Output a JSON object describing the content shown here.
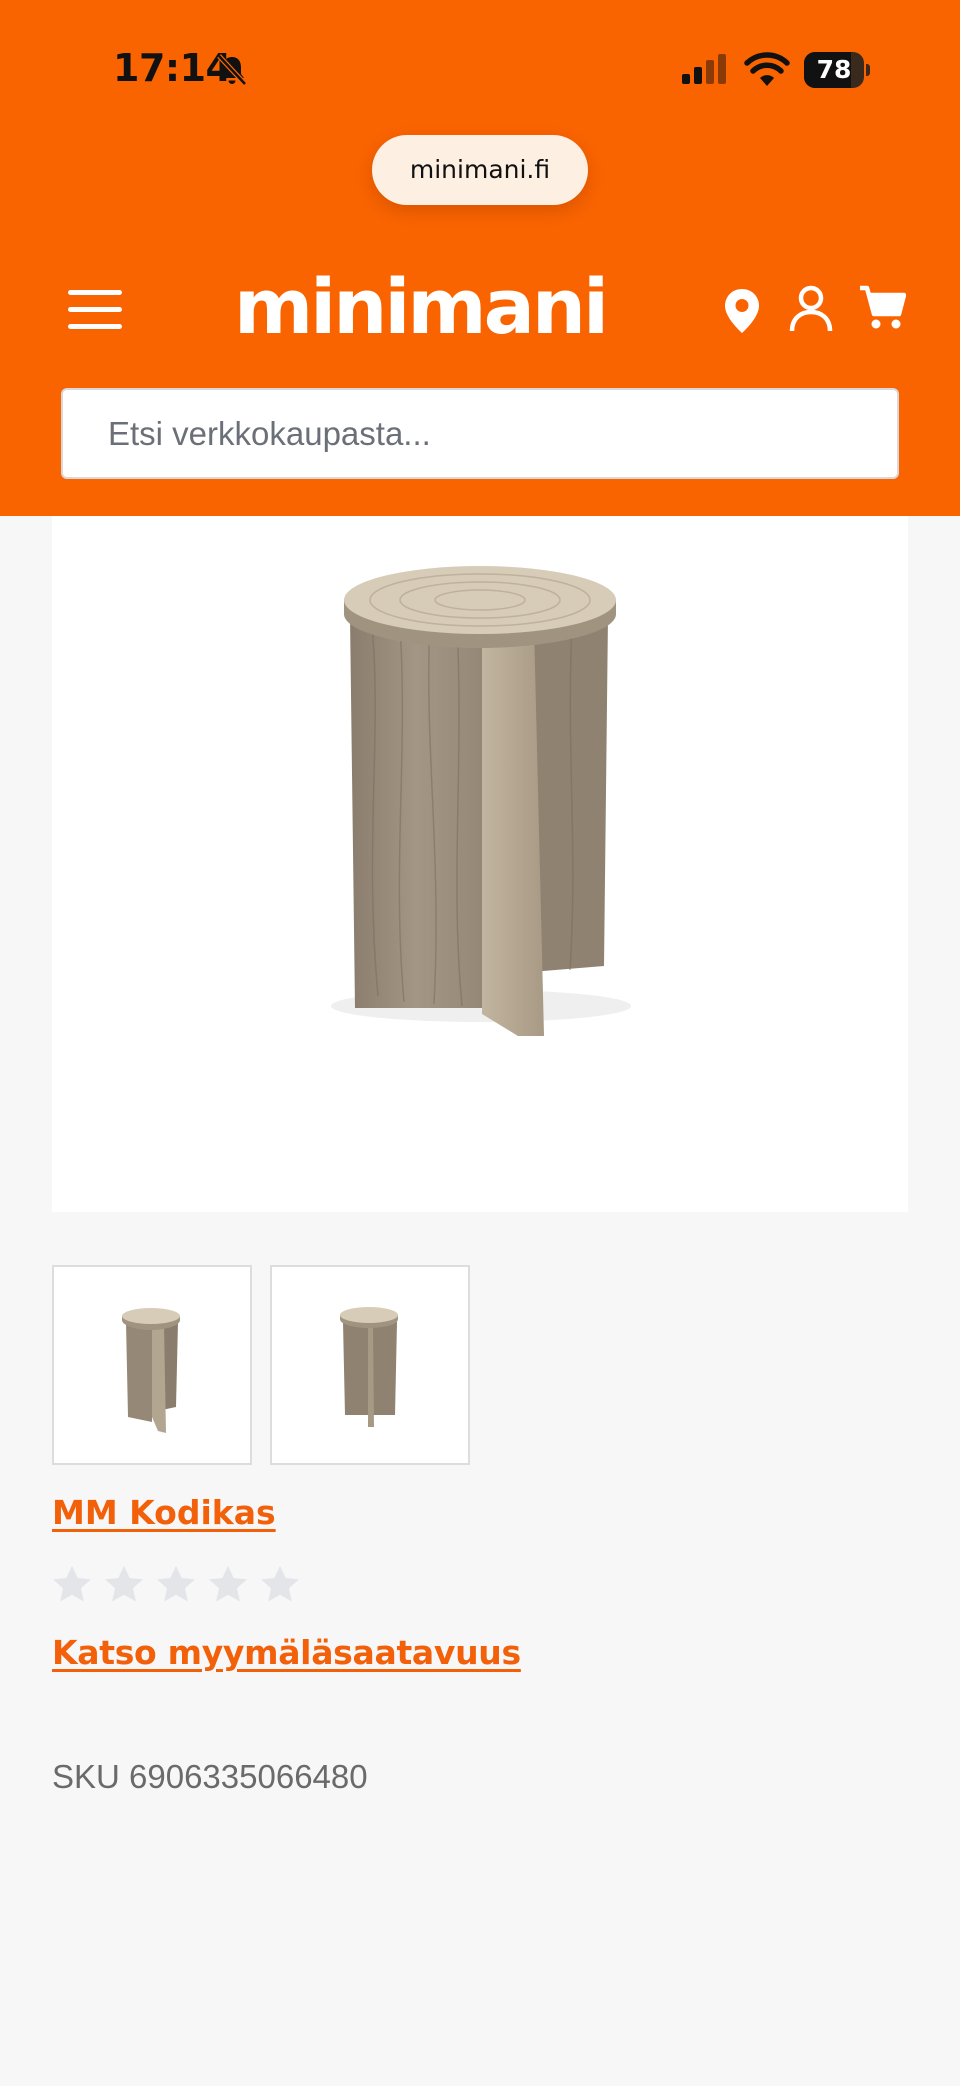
{
  "status_bar": {
    "time": "17:14",
    "battery_level": "78",
    "battery_fraction": 0.78,
    "icons": [
      "bell-slash-icon",
      "cellular-signal-icon",
      "wifi-icon",
      "battery-icon"
    ]
  },
  "browser": {
    "url": "minimani.fi"
  },
  "header": {
    "logo_text": "minimani",
    "icons": [
      "menu-icon",
      "store-location-icon",
      "account-icon",
      "cart-icon"
    ],
    "brand_color": "#fa6400"
  },
  "search": {
    "placeholder": "Etsi verkkokaupasta..."
  },
  "product": {
    "title": "MM Kodikas",
    "rating": 0,
    "rating_max": 5,
    "availability_link": "Katso myymäläsaatavuus",
    "sku_text": "SKU 6906335066480",
    "link_color": "#f2600a",
    "thumbnail_count": 2
  }
}
